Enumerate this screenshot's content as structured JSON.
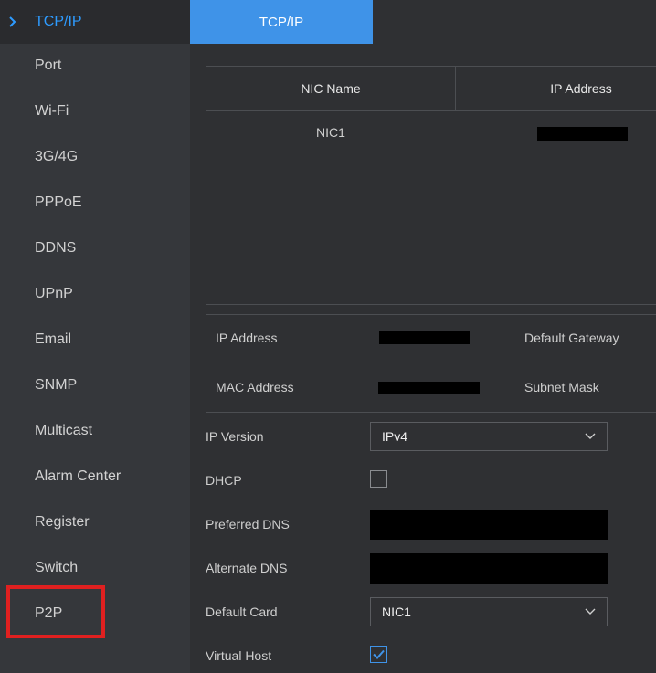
{
  "sidebar": {
    "items": [
      {
        "label": "TCP/IP",
        "active": true
      },
      {
        "label": "Port"
      },
      {
        "label": "Wi-Fi"
      },
      {
        "label": "3G/4G"
      },
      {
        "label": "PPPoE"
      },
      {
        "label": "DDNS"
      },
      {
        "label": "UPnP"
      },
      {
        "label": "Email"
      },
      {
        "label": "SNMP"
      },
      {
        "label": "Multicast"
      },
      {
        "label": "Alarm Center"
      },
      {
        "label": "Register"
      },
      {
        "label": "Switch"
      },
      {
        "label": "P2P",
        "highlighted": true
      }
    ]
  },
  "tab": {
    "label": "TCP/IP"
  },
  "nic_table": {
    "columns": [
      "NIC Name",
      "IP Address"
    ],
    "rows": [
      {
        "name": "NIC1"
      }
    ]
  },
  "info": {
    "ip_address_label": "IP Address",
    "mac_address_label": "MAC Address",
    "default_gateway_label": "Default Gateway",
    "subnet_mask_label": "Subnet Mask"
  },
  "form": {
    "ip_version_label": "IP Version",
    "ip_version_value": "IPv4",
    "dhcp_label": "DHCP",
    "dhcp_checked": false,
    "preferred_dns_label": "Preferred DNS",
    "alternate_dns_label": "Alternate DNS",
    "default_card_label": "Default Card",
    "default_card_value": "NIC1",
    "virtual_host_label": "Virtual Host",
    "virtual_host_checked": true
  },
  "colors": {
    "accent": "#3f93e8",
    "active_text": "#2e9bff",
    "highlight": "#e02020"
  }
}
